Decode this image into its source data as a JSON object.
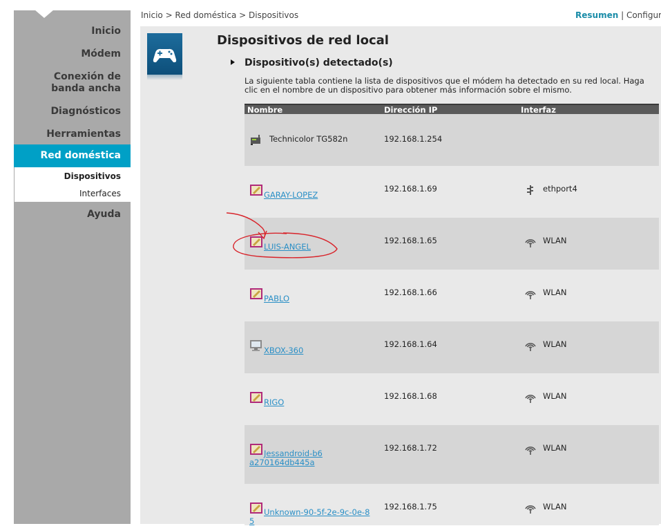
{
  "breadcrumb": "Inicio > Red doméstica > Dispositivos",
  "top_links": {
    "active": "Resumen",
    "separator": "|",
    "other": "Configura"
  },
  "sidebar": {
    "items": [
      {
        "label": "Inicio"
      },
      {
        "label": "Módem"
      },
      {
        "label": "Conexión de banda ancha"
      },
      {
        "label": "Diagnósticos"
      },
      {
        "label": "Herramientas"
      },
      {
        "label": "Red doméstica"
      },
      {
        "label": "Ayuda"
      }
    ],
    "subitems": [
      {
        "label": "Dispositivos"
      },
      {
        "label": "Interfaces"
      }
    ]
  },
  "page": {
    "title": "Dispositivos de red local",
    "section_title": "Dispositivo(s) detectado(s)",
    "description": "La siguiente tabla contiene la lista de dispositivos que el módem ha detectado en su red local. Haga clic en el nombre de un dispositivo para obtener más información sobre el mismo."
  },
  "table": {
    "headers": {
      "name": "Nombre",
      "ip": "Dirección IP",
      "interface": "Interfaz"
    },
    "rows": [
      {
        "name": "Technicolor TG582n",
        "ip": "192.168.1.254",
        "interface": "",
        "icon": "modem-icon",
        "link": false
      },
      {
        "name": "GARAY-LOPEZ",
        "ip": "192.168.1.69",
        "interface": "ethport4",
        "icon": "computer-icon",
        "link": true,
        "if_icon": "ethernet-icon"
      },
      {
        "name": "LUIS-ANGEL",
        "ip": "192.168.1.65",
        "interface": "WLAN",
        "icon": "computer-icon",
        "link": true,
        "if_icon": "wifi-icon"
      },
      {
        "name": "PABLO",
        "ip": "192.168.1.66",
        "interface": "WLAN",
        "icon": "computer-icon",
        "link": true,
        "if_icon": "wifi-icon"
      },
      {
        "name": "XBOX-360",
        "ip": "192.168.1.64",
        "interface": "WLAN",
        "icon": "monitor-icon",
        "link": true,
        "if_icon": "wifi-icon"
      },
      {
        "name": "RIGO",
        "ip": "192.168.1.68",
        "interface": "WLAN",
        "icon": "computer-icon",
        "link": true,
        "if_icon": "wifi-icon"
      },
      {
        "name": "Jessandroid-b6a270164db445a",
        "ip": "192.168.1.72",
        "interface": "WLAN",
        "icon": "computer-icon",
        "link": true,
        "if_icon": "wifi-icon"
      },
      {
        "name": "Unknown-90-5f-2e-9c-0e-85",
        "ip": "192.168.1.75",
        "interface": "WLAN",
        "icon": "computer-icon",
        "link": true,
        "if_icon": "wifi-icon"
      }
    ]
  },
  "colors": {
    "accent": "#00a0c6",
    "sidebar": "#a9a9a9",
    "link": "#2a8fc6",
    "annotation": "#d8232a"
  }
}
